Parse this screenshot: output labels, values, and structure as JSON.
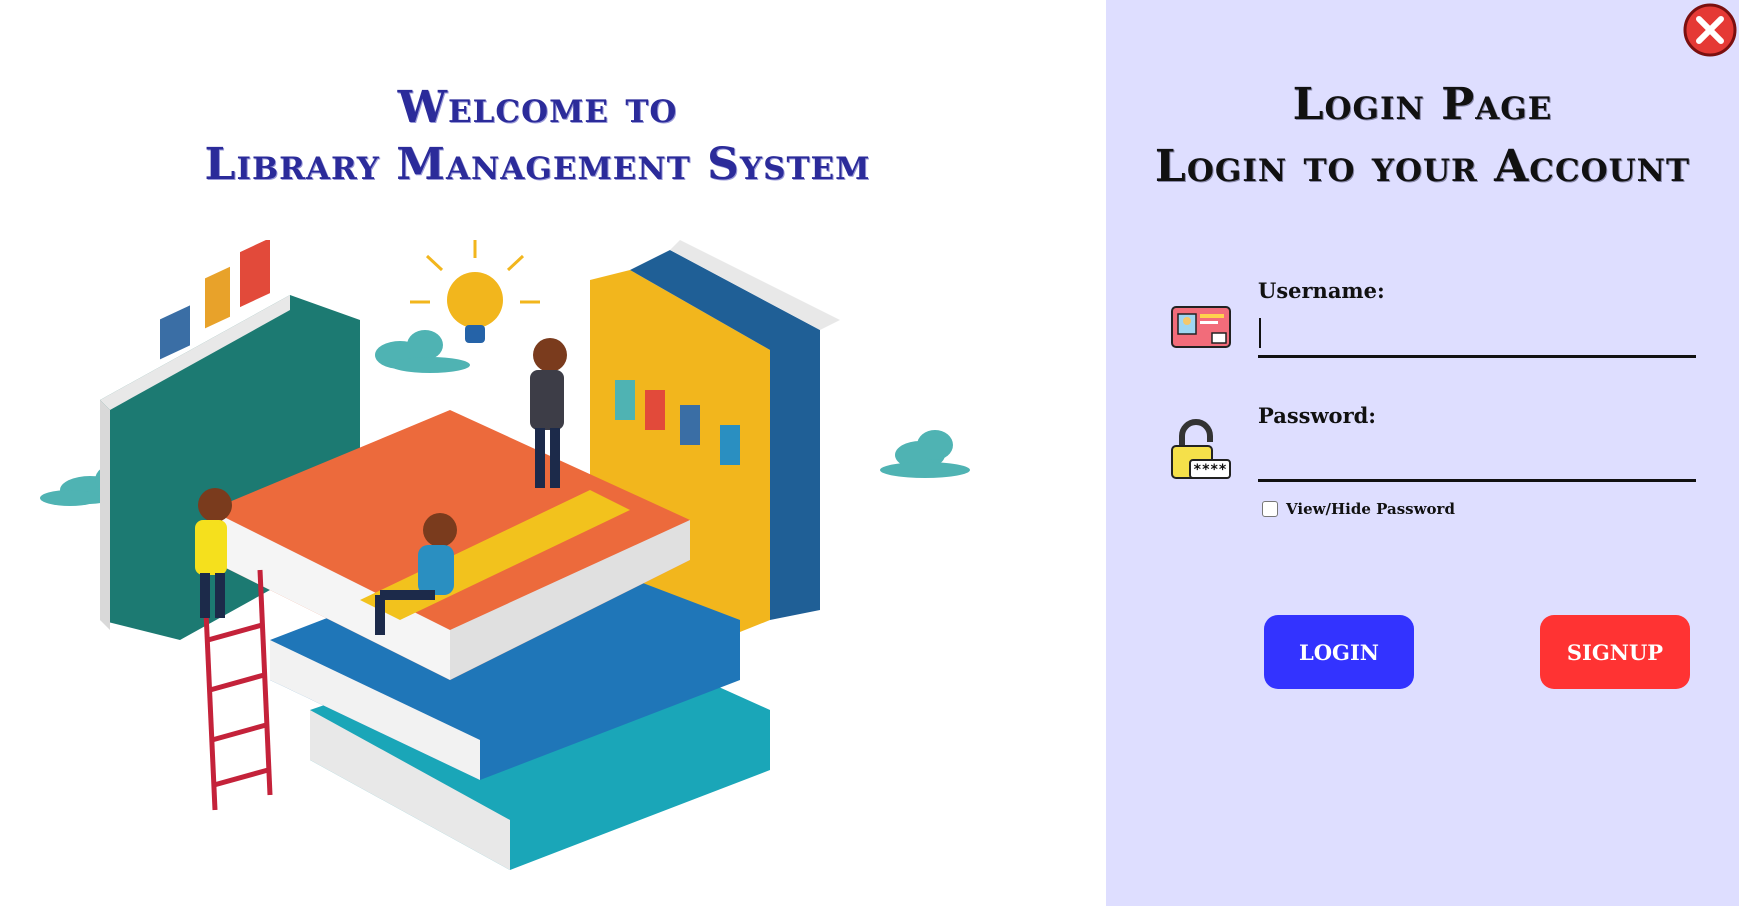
{
  "welcome": {
    "line1": "Welcome to",
    "line2": "Library Management System"
  },
  "login": {
    "title": "Login Page",
    "subtitle": "Login to your Account",
    "username_label": "Username:",
    "username_value": "",
    "password_label": "Password:",
    "password_value": "",
    "show_password_label": "View/Hide Password",
    "show_password_checked": false,
    "login_button": "LOGIN",
    "signup_button": "SIGNUP"
  },
  "icons": {
    "close": "close-icon",
    "username": "id-card-icon",
    "password": "padlock-password-icon",
    "bulb": "lightbulb-icon"
  },
  "colors": {
    "right_panel_bg": "#dedeff",
    "welcome_text": "#2b2b9a",
    "login_button": "#3333ff",
    "signup_button": "#ff3333",
    "close_button": "#e53935"
  }
}
